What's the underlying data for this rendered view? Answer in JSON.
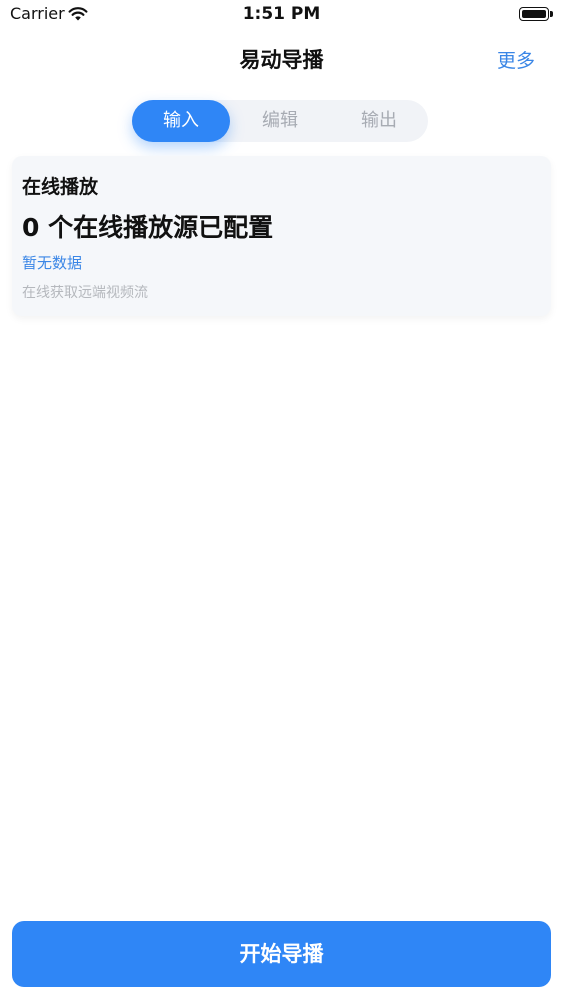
{
  "status_bar": {
    "carrier": "Carrier",
    "time": "1:51 PM",
    "wifi_icon": "wifi-icon",
    "battery_icon": "battery-icon"
  },
  "nav": {
    "title": "易动导播",
    "more_label": "更多"
  },
  "tabs": [
    {
      "label": "输入",
      "active": true
    },
    {
      "label": "编辑",
      "active": false
    },
    {
      "label": "输出",
      "active": false
    }
  ],
  "card": {
    "title": "在线播放",
    "count_text": "0 个在线播放源已配置",
    "empty_label": "暂无数据",
    "description": "在线获取远端视频流"
  },
  "start_button_label": "开始导播",
  "colors": {
    "accent": "#2f86f6",
    "link": "#3a86e6",
    "card_bg": "#f5f7fa",
    "muted_text": "#a7abb3"
  }
}
